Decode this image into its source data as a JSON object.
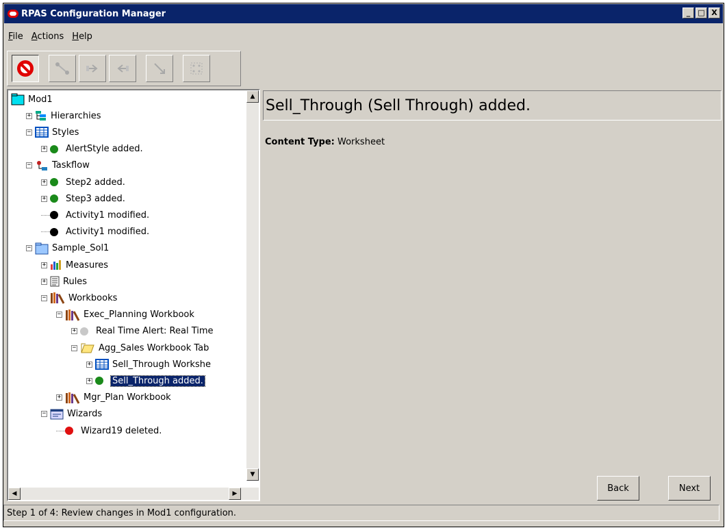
{
  "window": {
    "title": "RPAS Configuration Manager",
    "controls": [
      "_",
      "□",
      "X"
    ]
  },
  "menu": [
    {
      "label": "File",
      "u": "F"
    },
    {
      "label": "Actions",
      "u": "A"
    },
    {
      "label": "Help",
      "u": "H"
    }
  ],
  "toolbar": {
    "buttons": [
      {
        "icon": "stop-icon",
        "enabled": true
      },
      {
        "icon": "connect-icon",
        "enabled": false
      },
      {
        "icon": "forward-icon",
        "enabled": false
      },
      {
        "icon": "back-icon",
        "enabled": false
      },
      {
        "icon": "diagonal-icon",
        "enabled": false
      },
      {
        "icon": "grid-icon",
        "enabled": false
      }
    ]
  },
  "tree": {
    "rows": [
      {
        "label": "Mod1",
        "icon": "folder-cyan-icon",
        "expander": "none"
      },
      {
        "label": "Hierarchies",
        "icon": "hierarchy-icon",
        "expander": "+"
      },
      {
        "label": "Styles",
        "icon": "grid-table-icon",
        "expander": "-"
      },
      {
        "label": "AlertStyle added.",
        "icon": "green-dot-icon",
        "expander": "+"
      },
      {
        "label": "Taskflow",
        "icon": "taskflow-icon",
        "expander": "-"
      },
      {
        "label": "Step2 added.",
        "icon": "green-dot-icon",
        "expander": "+"
      },
      {
        "label": "Step3 added.",
        "icon": "green-dot-icon",
        "expander": "+"
      },
      {
        "label": "Activity1 modified.",
        "icon": "black-dot-icon",
        "expander": "none"
      },
      {
        "label": "Activity1 modified.",
        "icon": "black-dot-icon",
        "expander": "none"
      },
      {
        "label": "Sample_Sol1",
        "icon": "folder-blue-icon",
        "expander": "-"
      },
      {
        "label": "Measures",
        "icon": "measures-icon",
        "expander": "+"
      },
      {
        "label": "Rules",
        "icon": "rules-icon",
        "expander": "+"
      },
      {
        "label": "Workbooks",
        "icon": "books-icon",
        "expander": "-"
      },
      {
        "label": "Exec_Planning Workbook",
        "icon": "books-icon",
        "expander": "-"
      },
      {
        "label": "Real Time Alert: Real Time",
        "icon": "gray-dot-icon",
        "expander": "+"
      },
      {
        "label": "Agg_Sales Workbook Tab",
        "icon": "folder-open-icon",
        "expander": "-"
      },
      {
        "label": "Sell_Through Workshe",
        "icon": "grid-table-icon",
        "expander": "+"
      },
      {
        "label": "Sell_Through added.",
        "icon": "green-dot-icon",
        "expander": "+",
        "selected": true
      },
      {
        "label": "Mgr_Plan Workbook",
        "icon": "books-icon",
        "expander": "+"
      },
      {
        "label": "Wizards",
        "icon": "wizard-icon",
        "expander": "-"
      },
      {
        "label": "Wizard19 deleted.",
        "icon": "red-dot-icon",
        "expander": "none"
      }
    ]
  },
  "detail": {
    "header": "Sell_Through (Sell Through) added.",
    "content_type_label": "Content Type:",
    "content_type_value": "Worksheet"
  },
  "nav": {
    "back": "Back",
    "next": "Next"
  },
  "status": "Step 1 of 4: Review changes in Mod1 configuration.",
  "colors": {
    "titlebar": "#0a246a",
    "chrome": "#d4d0c8",
    "added": "#1a8a1a",
    "deleted": "#e01010",
    "modified": "#000000"
  }
}
